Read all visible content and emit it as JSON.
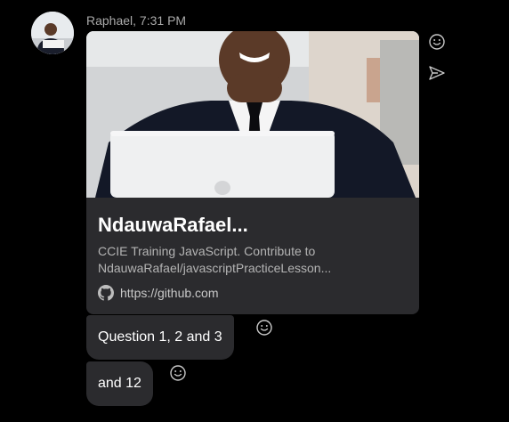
{
  "message": {
    "sender": "Raphael, 7:31 PM",
    "link_preview": {
      "title": "NdauwaRafael...",
      "description": "CCIE Training JavaScript. Contribute to NdauwaRafael/javascriptPracticeLesson...",
      "url": "https://github.com"
    },
    "replies": [
      {
        "text": "Question 1, 2 and 3"
      },
      {
        "text": "and 12"
      }
    ]
  },
  "actions": {
    "react_icon": "smiley-icon",
    "forward_icon": "send-icon"
  },
  "colors": {
    "background": "#000000",
    "bubble": "#2b2b2e",
    "text": "#ffffff",
    "muted_text": "#a9a9a9"
  }
}
